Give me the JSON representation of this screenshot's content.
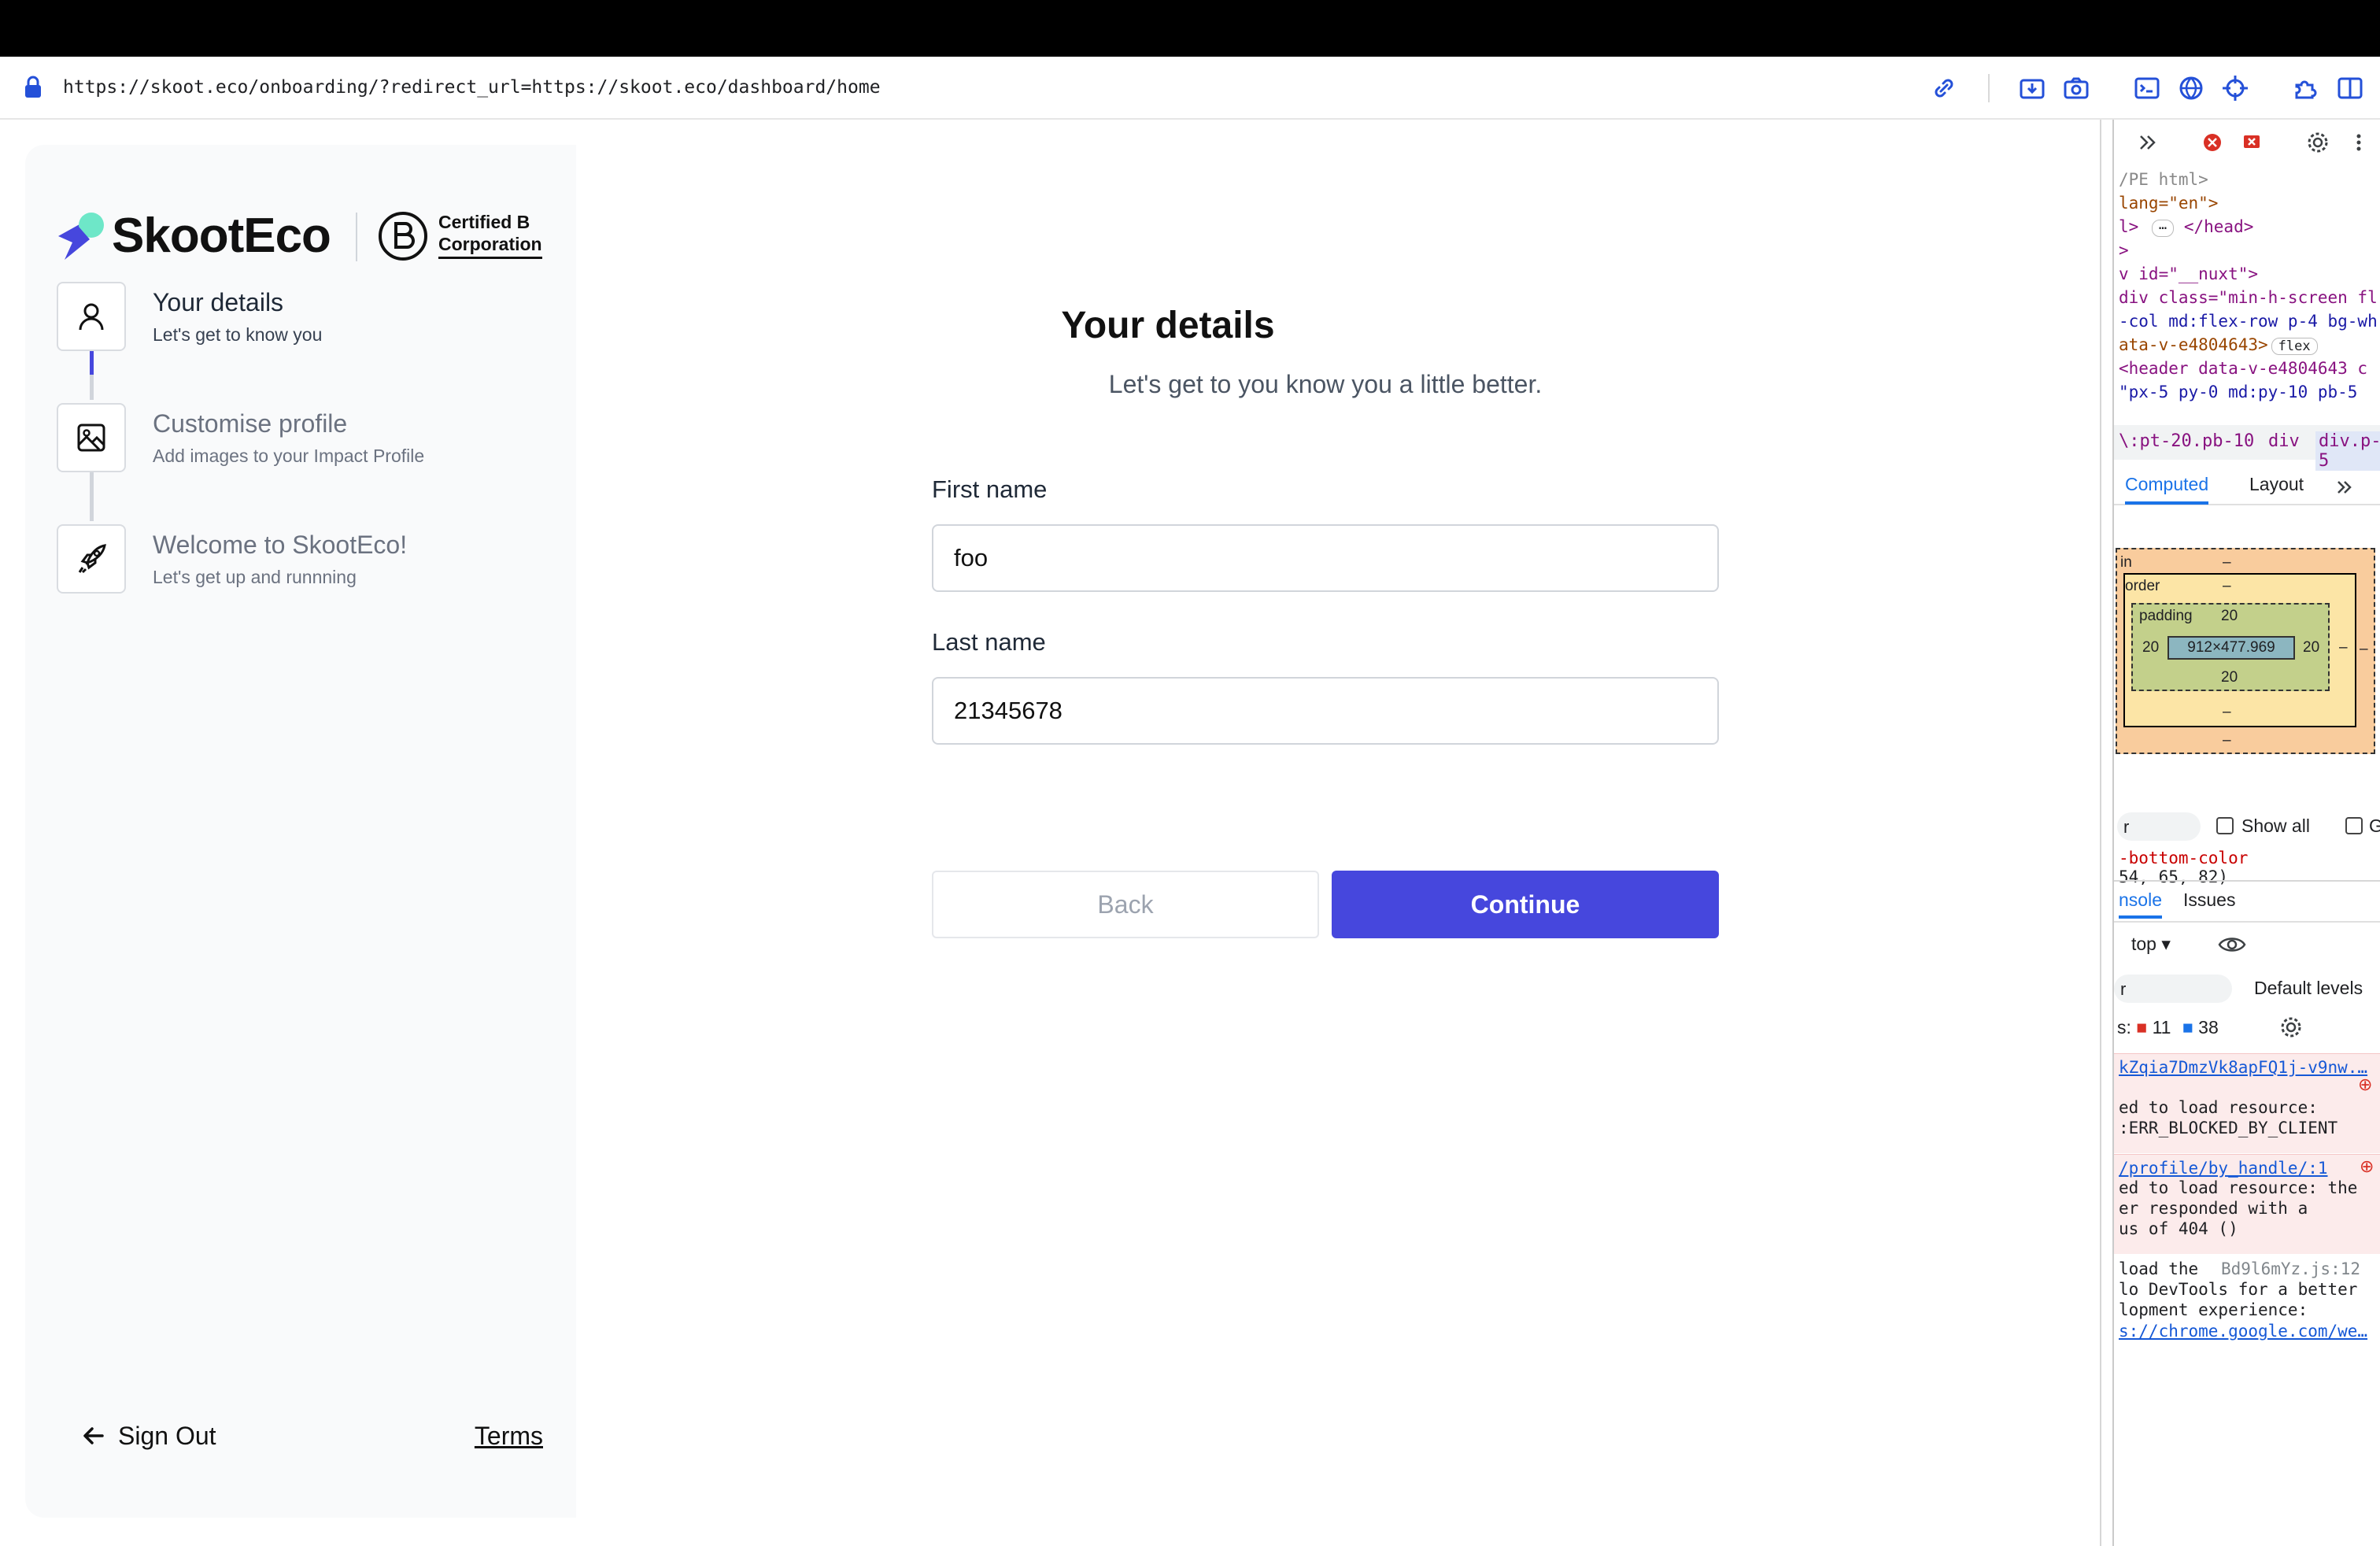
{
  "browser": {
    "url": "https://skoot.eco/onboarding/?redirect_url=https://skoot.eco/dashboard/home"
  },
  "brand": {
    "name": "SkootEco",
    "cert_line1": "Certified B",
    "cert_line2": "Corporation",
    "accent_color": "#4647dd"
  },
  "steps": [
    {
      "title": "Your details",
      "desc": "Let's get to know you",
      "icon": "user-icon",
      "active": true
    },
    {
      "title": "Customise profile",
      "desc": "Add images to your Impact Profile",
      "icon": "image-icon",
      "active": false
    },
    {
      "title": "Welcome to SkootEco!",
      "desc": "Let's get up and runnning",
      "icon": "rocket-icon",
      "active": false
    }
  ],
  "sidebar_footer": {
    "sign_out": "Sign Out",
    "terms": "Terms"
  },
  "form": {
    "title": "Your details",
    "subtitle": "Let's get to you know you a little better.",
    "first_name_label": "First name",
    "first_name_value": "foo",
    "last_name_label": "Last name",
    "last_name_value": "21345678",
    "back_label": "Back",
    "continue_label": "Continue"
  },
  "devtools": {
    "html_lines": [
      "/PE html>",
      "lang=\"en\">",
      "l>",
      "</head>",
      "v id=\"__nuxt\">",
      "div class=\"min-h-screen fl",
      "-col md:flex-row p-4 bg-wh",
      "ata-v-e4804643>",
      "flex",
      "<header data-v-e4804643 c",
      "\"px-5 py-0 md:py-10 pb-5"
    ],
    "crumb1": "\\:pt-20.pb-10",
    "crumb2": "div",
    "crumb3": "div.p-5",
    "tab_computed": "Computed",
    "tab_layout": "Layout",
    "bm_margin": "in",
    "bm_border": "order",
    "bm_padding": "padding",
    "bm_pad_val": "20",
    "bm_content": "912×477.969",
    "bm_dash": "–",
    "filter_text": "r",
    "show_all": "Show all",
    "group": "Gr",
    "prop1": "-bottom-color",
    "prop2": "54, 65, 82)",
    "console_tab": "nsole",
    "issues_tab": "Issues",
    "context": "top",
    "default_levels": "Default levels",
    "issues_prefix": "s:",
    "error_count": "11",
    "info_count": "38",
    "msg1_link": "kZqia7DmzVk8apFQ1j-v9nw.…",
    "msg1_l1": "ed to load resource:",
    "msg1_l2": ":ERR_BLOCKED_BY_CLIENT",
    "msg2_link": "/profile/by_handle/:1",
    "msg2_l1": "ed to load resource: the",
    "msg2_l2": "er responded with a",
    "msg2_l3": "us of 404 ()",
    "msg3_l1": "load the",
    "msg3_src": "Bd9l6mYz.js:12",
    "msg3_l2": "lo DevTools for a better",
    "msg3_l3": "lopment experience:",
    "msg3_link": "s://chrome.google.com/we…"
  }
}
